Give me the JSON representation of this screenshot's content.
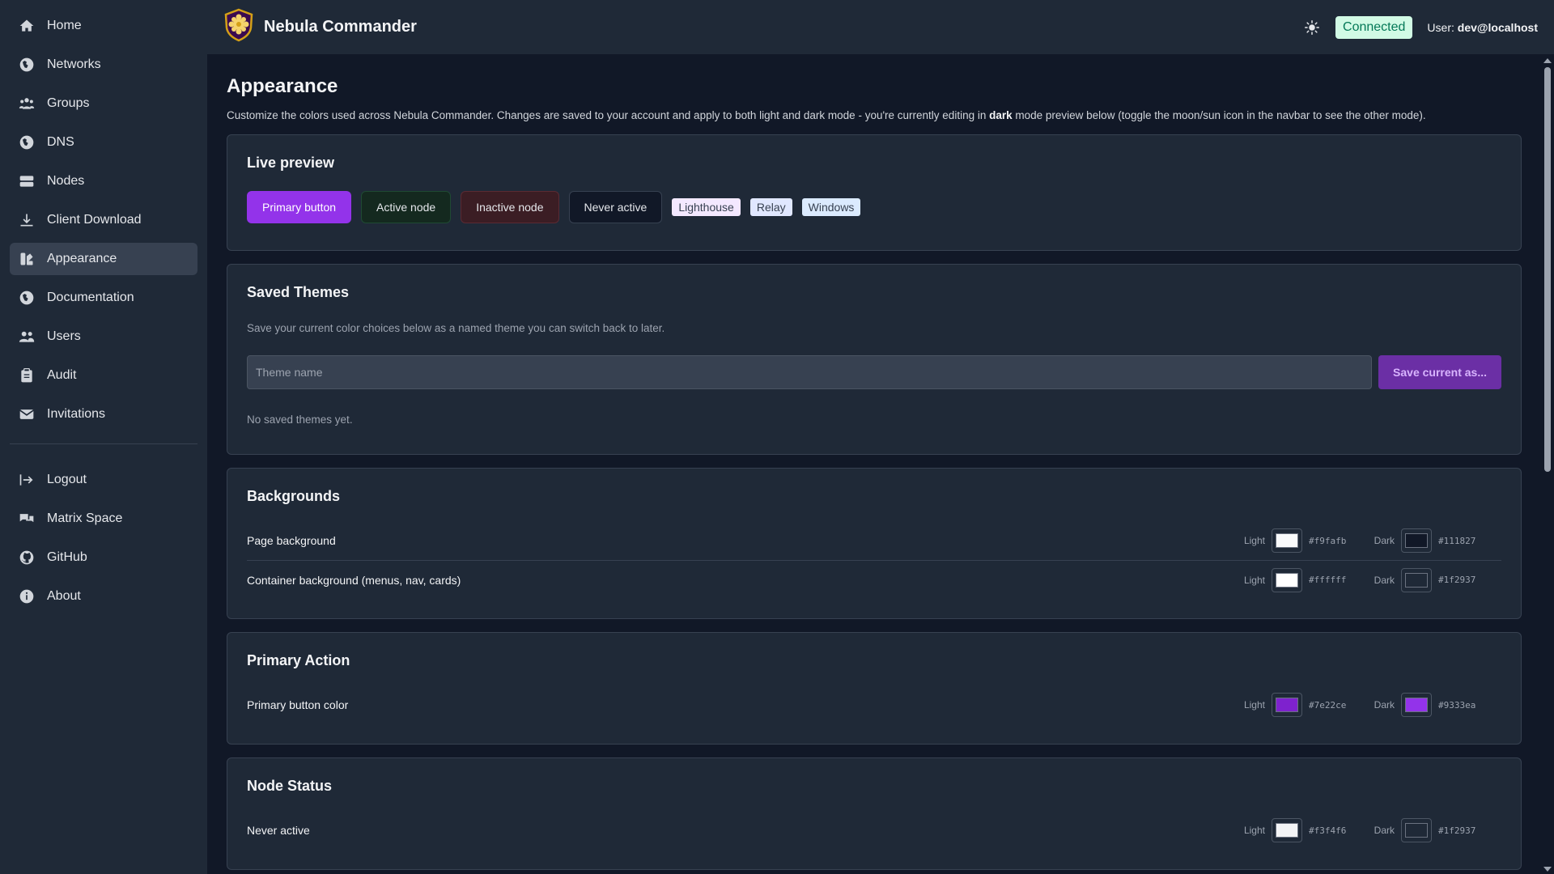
{
  "app": {
    "title": "Nebula Commander"
  },
  "header": {
    "status": "Connected",
    "user_prefix": "User:",
    "user_name": "dev@localhost",
    "theme_toggle_icon": "sun-icon"
  },
  "sidebar": {
    "items": [
      {
        "label": "Home",
        "icon": "home-icon"
      },
      {
        "label": "Networks",
        "icon": "globe-icon"
      },
      {
        "label": "Groups",
        "icon": "users-group-icon"
      },
      {
        "label": "DNS",
        "icon": "globe-icon"
      },
      {
        "label": "Nodes",
        "icon": "server-icon"
      },
      {
        "label": "Client Download",
        "icon": "download-icon"
      },
      {
        "label": "Appearance",
        "icon": "palette-icon",
        "active": true
      },
      {
        "label": "Documentation",
        "icon": "globe-icon"
      },
      {
        "label": "Users",
        "icon": "users-icon"
      },
      {
        "label": "Audit",
        "icon": "clipboard-icon"
      },
      {
        "label": "Invitations",
        "icon": "envelope-icon"
      }
    ],
    "bottom_items": [
      {
        "label": "Logout",
        "icon": "logout-icon"
      },
      {
        "label": "Matrix Space",
        "icon": "chat-icon"
      },
      {
        "label": "GitHub",
        "icon": "github-icon"
      },
      {
        "label": "About",
        "icon": "info-icon"
      }
    ]
  },
  "page": {
    "title": "Appearance",
    "desc_before": "Customize the colors used across Nebula Commander. Changes are saved to your account and apply to both light and dark mode - you're currently editing in ",
    "desc_mode": "dark",
    "desc_after": " mode preview below (toggle the moon/sun icon in the navbar to see the other mode)."
  },
  "live_preview": {
    "title": "Live preview",
    "primary_button": "Primary button",
    "active_node": "Active node",
    "inactive_node": "Inactive node",
    "never_active": "Never active",
    "tags": [
      "Lighthouse",
      "Relay",
      "Windows"
    ]
  },
  "saved_themes": {
    "title": "Saved Themes",
    "description": "Save your current color choices below as a named theme you can switch back to later.",
    "input_placeholder": "Theme name",
    "input_value": "",
    "save_button": "Save current as...",
    "empty_text": "No saved themes yet."
  },
  "mode_labels": {
    "light": "Light",
    "dark": "Dark"
  },
  "sections": [
    {
      "title": "Backgrounds",
      "rows": [
        {
          "label": "Page background",
          "light": "#f9fafb",
          "dark": "#111827"
        },
        {
          "label": "Container background (menus, nav, cards)",
          "light": "#ffffff",
          "dark": "#1f2937"
        }
      ]
    },
    {
      "title": "Primary Action",
      "rows": [
        {
          "label": "Primary button color",
          "light": "#7e22ce",
          "dark": "#9333ea"
        }
      ]
    },
    {
      "title": "Node Status",
      "rows": [
        {
          "label": "Never active",
          "light": "#f3f4f6",
          "dark": "#1f2937"
        }
      ]
    }
  ],
  "colors": {
    "accent": "#9333ea",
    "page_bg": "#111827",
    "container_bg": "#1f2937",
    "connected_bg": "#d1fae5"
  }
}
